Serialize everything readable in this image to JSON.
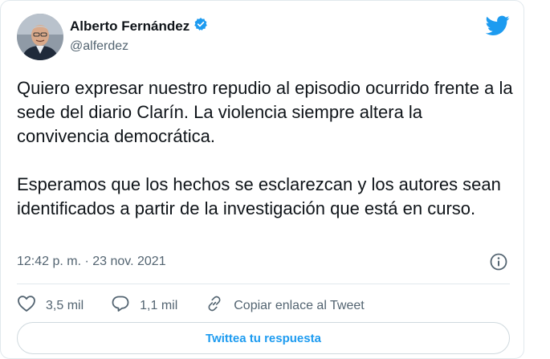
{
  "author": {
    "name": "Alberto Fernández",
    "handle": "@alferdez"
  },
  "tweet": {
    "paragraphs": [
      "Quiero expresar nuestro repudio al episodio ocurrido frente a la sede del diario Clarín. La violencia siempre altera la convivencia democrática.",
      "Esperamos que los hechos se esclarezcan y los autores sean identificados a partir de la investigación que está en curso."
    ],
    "timestamp": "12:42 p. m. · 23 nov. 2021"
  },
  "actions": {
    "likes": "3,5 mil",
    "replies": "1,1 mil",
    "copy_link": "Copiar enlace al Tweet"
  },
  "reply_button": "Twittea tu respuesta",
  "icons": [
    "avatar",
    "verified-badge-icon",
    "twitter-bird-icon",
    "info-icon",
    "heart-icon",
    "reply-icon",
    "link-icon"
  ],
  "colors": {
    "accent": "#1d9bf0",
    "text": "#0f1419",
    "secondary": "#536471",
    "border": "#e1e8ed"
  }
}
